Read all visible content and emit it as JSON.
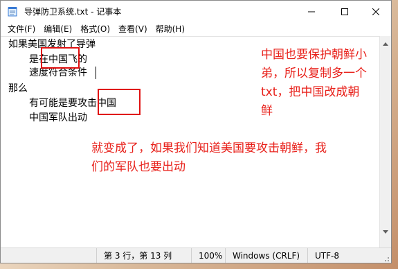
{
  "window": {
    "title": "导弹防卫系统.txt - 记事本"
  },
  "menu": {
    "items": [
      "文件(F)",
      "编辑(E)",
      "格式(O)",
      "查看(V)",
      "帮助(H)"
    ]
  },
  "editor": {
    "lines": [
      "如果美国发射了导弹",
      "是在中国飞的",
      "速度符合条件",
      "那么",
      "有可能是要攻击中国",
      "中国军队出动"
    ]
  },
  "annotations": {
    "note1": [
      "中国也要保护朝鲜小",
      "弟，所以复制多一个",
      "txt，把中国改成朝",
      "鲜"
    ],
    "note2": [
      "就变成了，如果我们知道美国要攻击朝鲜，我",
      "们的军队也要出动"
    ]
  },
  "status": {
    "position": "第 3 行，第 13 列",
    "zoom": "100%",
    "line_ending": "Windows (CRLF)",
    "encoding": "UTF-8"
  },
  "colors": {
    "annotation": "#e8201a",
    "highlight_box": "#e01010"
  },
  "icons": {
    "app": "notepad-icon",
    "minimize": "minimize-icon",
    "maximize": "maximize-icon",
    "close": "close-icon"
  }
}
